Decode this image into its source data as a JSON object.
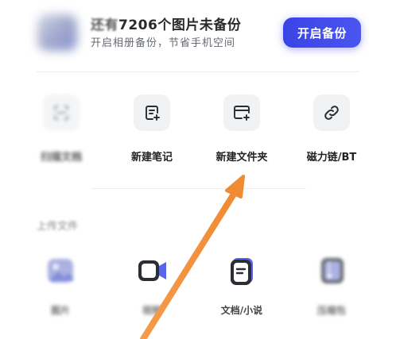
{
  "backup": {
    "title_prefix": "还有",
    "count": "7206",
    "title_suffix": "个图片未备份",
    "subtitle": "开启相册备份，节省手机空间",
    "button_label": "开启备份",
    "accent_color": "#3f49ea"
  },
  "actions": [
    {
      "label": "扫描文档",
      "icon": "scan-icon"
    },
    {
      "label": "新建笔记",
      "icon": "new-note-icon"
    },
    {
      "label": "新建文件夹",
      "icon": "new-folder-icon"
    },
    {
      "label": "磁力链/BT",
      "icon": "link-icon"
    }
  ],
  "recent": {
    "title": "上传文件",
    "categories": [
      {
        "label": "图片",
        "icon": "image-icon"
      },
      {
        "label": "视频",
        "icon": "video-icon"
      },
      {
        "label": "文档/小说",
        "icon": "document-icon"
      },
      {
        "label": "压缩包",
        "icon": "archive-icon"
      }
    ]
  },
  "annotation": {
    "arrow_color": "#f28c38",
    "points_to": "新建文件夹"
  }
}
